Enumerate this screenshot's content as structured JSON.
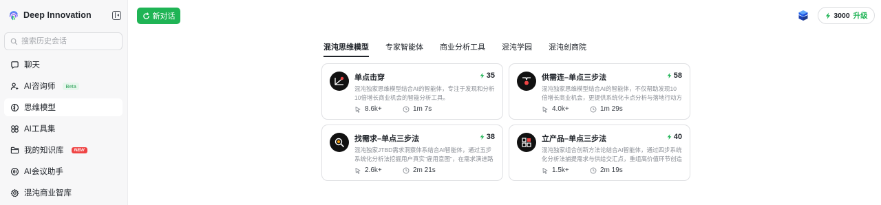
{
  "brand": {
    "name": "Deep Innovation"
  },
  "sidebar": {
    "search_placeholder": "搜索历史会话",
    "items": [
      {
        "label": "聊天",
        "icon": "chat-icon"
      },
      {
        "label": "AI咨询师",
        "icon": "consultant-icon",
        "badge": "Beta"
      },
      {
        "label": "思维模型",
        "icon": "model-icon",
        "active": true
      },
      {
        "label": "AI工具集",
        "icon": "tools-icon"
      },
      {
        "label": "我的知识库",
        "icon": "folder-icon",
        "badge": "NEW"
      },
      {
        "label": "AI会议助手",
        "icon": "meeting-icon"
      },
      {
        "label": "混沌商业智库",
        "icon": "gear-icon"
      }
    ]
  },
  "header": {
    "new_chat_label": "新对话",
    "credits": "3000",
    "upgrade_label": "升级"
  },
  "tabs": [
    {
      "label": "混沌思维模型",
      "active": true
    },
    {
      "label": "专家智能体"
    },
    {
      "label": "商业分析工具"
    },
    {
      "label": "混沌学园"
    },
    {
      "label": "混沌创商院"
    }
  ],
  "cards": [
    {
      "title": "单点击穿",
      "score": "35",
      "desc": "混沌独家思维模型结合AI的智能体，专注于发现和分析10倍增长商业机会的智能分析工具。",
      "uses": "8.6k+",
      "time": "1m 7s"
    },
    {
      "title": "供需连–单点三步法",
      "score": "58",
      "desc": "混沌独家思维模型结合AI的智能体，不仅帮助发现10倍增长商业机会，更提供系统化卡点分析与落地行动方案的…",
      "uses": "4.0k+",
      "time": "1m 29s"
    },
    {
      "title": "找需求–单点三步法",
      "score": "38",
      "desc": "混沌独家JTBD需求洞察体系结合AI智能体，通过五步系统化分析法挖掘用户真实\"雇用意图\"，在需求演进路径上…",
      "uses": "2.6k+",
      "time": "2m 21s"
    },
    {
      "title": "立产品–单点三步法",
      "score": "40",
      "desc": "混沌独家组合创新方法论结合AI智能体，通过四步系统化分析法捕提需求与供给交汇点，重组高价值环节创造颠…",
      "uses": "1.5k+",
      "time": "2m 19s"
    }
  ],
  "colors": {
    "accent": "#1fb455",
    "text": "#1f2329",
    "muted": "#8a8e95",
    "sidebar_bg": "#f7f7f8"
  }
}
